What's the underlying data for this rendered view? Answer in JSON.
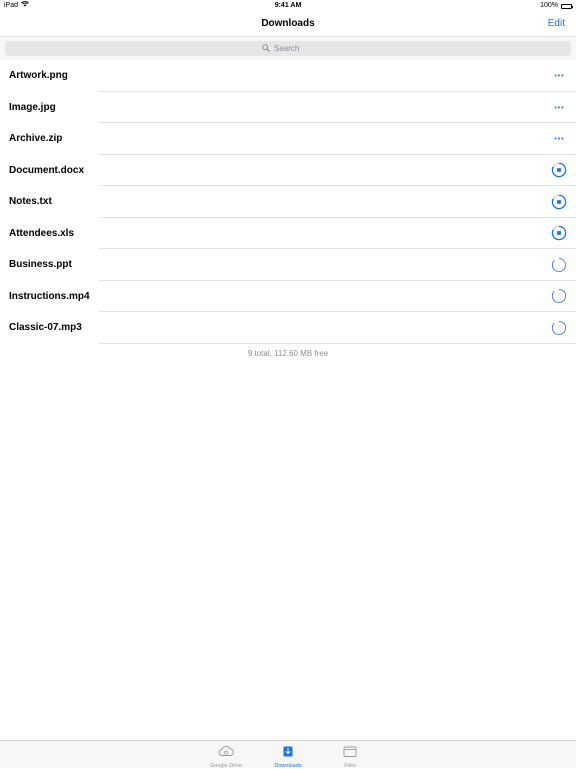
{
  "status": {
    "device": "iPad",
    "time": "9:41 AM",
    "battery": "100%"
  },
  "nav": {
    "title": "Downloads",
    "edit_label": "Edit"
  },
  "search": {
    "placeholder": "Search"
  },
  "files": [
    {
      "name": "Artwork.png",
      "state": "more"
    },
    {
      "name": "Image.jpg",
      "state": "more"
    },
    {
      "name": "Archive.zip",
      "state": "more"
    },
    {
      "name": "Document.docx",
      "state": "downloading"
    },
    {
      "name": "Notes.txt",
      "state": "downloading"
    },
    {
      "name": "Attendees.xls",
      "state": "downloading"
    },
    {
      "name": "Business.ppt",
      "state": "queued"
    },
    {
      "name": "Instructions.mp4",
      "state": "queued"
    },
    {
      "name": "Classic-07.mp3",
      "state": "queued"
    }
  ],
  "summary": "9 total, 112.60 MB free",
  "tabs": [
    {
      "label": "Google Drive",
      "icon": "cloud-icon",
      "active": false
    },
    {
      "label": "Downloads",
      "icon": "downloads-icon",
      "active": true
    },
    {
      "label": "Files",
      "icon": "files-icon",
      "active": false
    }
  ],
  "colors": {
    "accent": "#1a73e8",
    "secondary_text": "#8e8e93",
    "separator": "#e3e3e3"
  }
}
